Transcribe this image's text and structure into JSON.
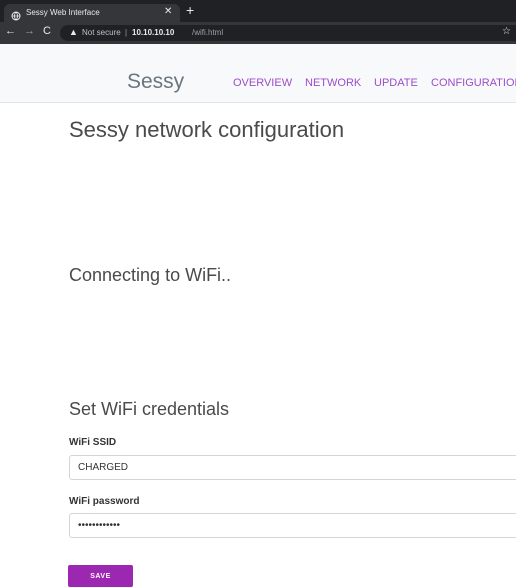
{
  "browser": {
    "tab_title": "Sessy Web Interface",
    "tab_close_icon": "close-icon",
    "new_tab_icon": "plus-icon",
    "back_icon": "arrow-left-icon",
    "forward_icon": "arrow-right-icon",
    "reload_icon": "reload-icon",
    "security_label": "Not secure",
    "url_separator": "|",
    "url_host": "10.10.10.10",
    "url_path": "/wifi.html",
    "bookmark_icon": "star-icon"
  },
  "navbar": {
    "brand": "Sessy",
    "links": [
      "OVERVIEW",
      "NETWORK",
      "UPDATE",
      "CONFIGURATION"
    ],
    "link_color": "#9c4dcc"
  },
  "main": {
    "title": "Sessy network configuration",
    "status": "Connecting to WiFi..",
    "credentials_heading": "Set WiFi credentials",
    "ssid_label": "WiFi SSID",
    "ssid_value": "CHARGED",
    "password_label": "WiFi password",
    "password_value": "••••••••••••",
    "save_label": "SAVE",
    "accent_color": "#9c27b0"
  }
}
